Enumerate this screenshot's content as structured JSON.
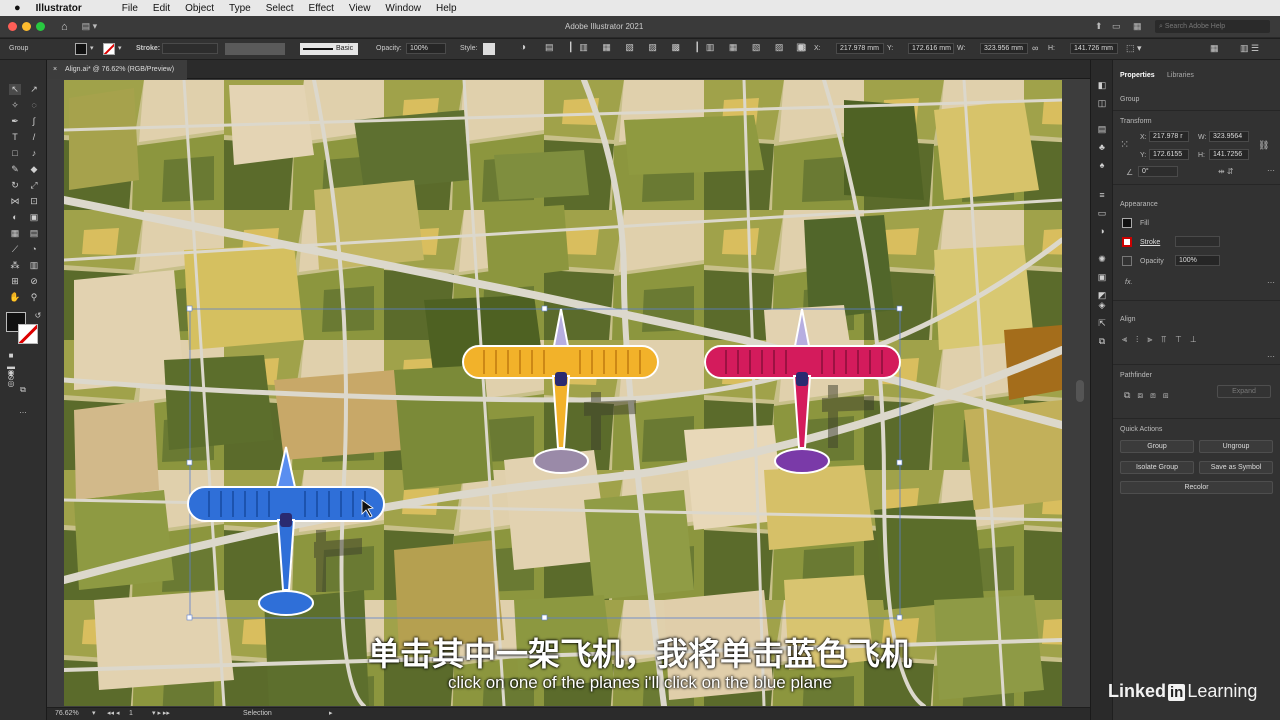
{
  "mac_menu": {
    "app": "Illustrator",
    "items": [
      "File",
      "Edit",
      "Object",
      "Type",
      "Select",
      "Effect",
      "View",
      "Window",
      "Help"
    ]
  },
  "window": {
    "title": "Adobe Illustrator 2021",
    "search_placeholder": "Search Adobe Help"
  },
  "control_bar": {
    "selection_type": "Group",
    "stroke_label": "Stroke:",
    "brush_label": "Basic",
    "opacity_label": "Opacity:",
    "opacity_value": "100%",
    "style_label": "Style:",
    "x_label": "X:",
    "x_value": "217.978 mm",
    "y_label": "Y:",
    "y_value": "172.616 mm",
    "w_label": "W:",
    "w_value": "323.956 mm",
    "h_label": "H:",
    "h_value": "141.726 mm"
  },
  "document": {
    "tab_label": "Align.ai* @ 76.62% (RGB/Preview)",
    "close": "×"
  },
  "status": {
    "zoom": "76.62%",
    "artboard": "1",
    "tool": "Selection"
  },
  "properties": {
    "tabs": [
      "Properties",
      "Libraries"
    ],
    "selection": "Group",
    "transform": {
      "title": "Transform",
      "x_label": "X:",
      "x": "217.978 r",
      "y_label": "Y:",
      "y": "172.6155",
      "w_label": "W:",
      "w": "323.9564",
      "h_label": "H:",
      "h": "141.7256",
      "angle": "0°"
    },
    "appearance": {
      "title": "Appearance",
      "fill": "Fill",
      "stroke": "Stroke",
      "opacity_label": "Opacity",
      "opacity": "100%",
      "fx": "fx."
    },
    "align_title": "Align",
    "pathfinder": {
      "title": "Pathfinder",
      "expand": "Expand"
    },
    "quick_actions": {
      "title": "Quick Actions",
      "group": "Group",
      "ungroup": "Ungroup",
      "isolate": "Isolate Group",
      "save_symbol": "Save as Symbol",
      "recolor": "Recolor"
    }
  },
  "subtitles": {
    "zh": "单击其中一架飞机，我将单击蓝色飞机",
    "en": "click on one of the planes i'll click on the blue plane"
  },
  "brand": {
    "name": "Linked",
    "in": "in",
    "suffix": "Learning"
  },
  "colors": {
    "blue_plane": "#2f6fd8",
    "yellow_plane": "#f2b22a",
    "red_plane": "#d41b5c",
    "field_light": "#e2d2b0",
    "field_olive": "#8d9a40",
    "field_dark": "#55682a",
    "road": "#dcd8cc"
  }
}
